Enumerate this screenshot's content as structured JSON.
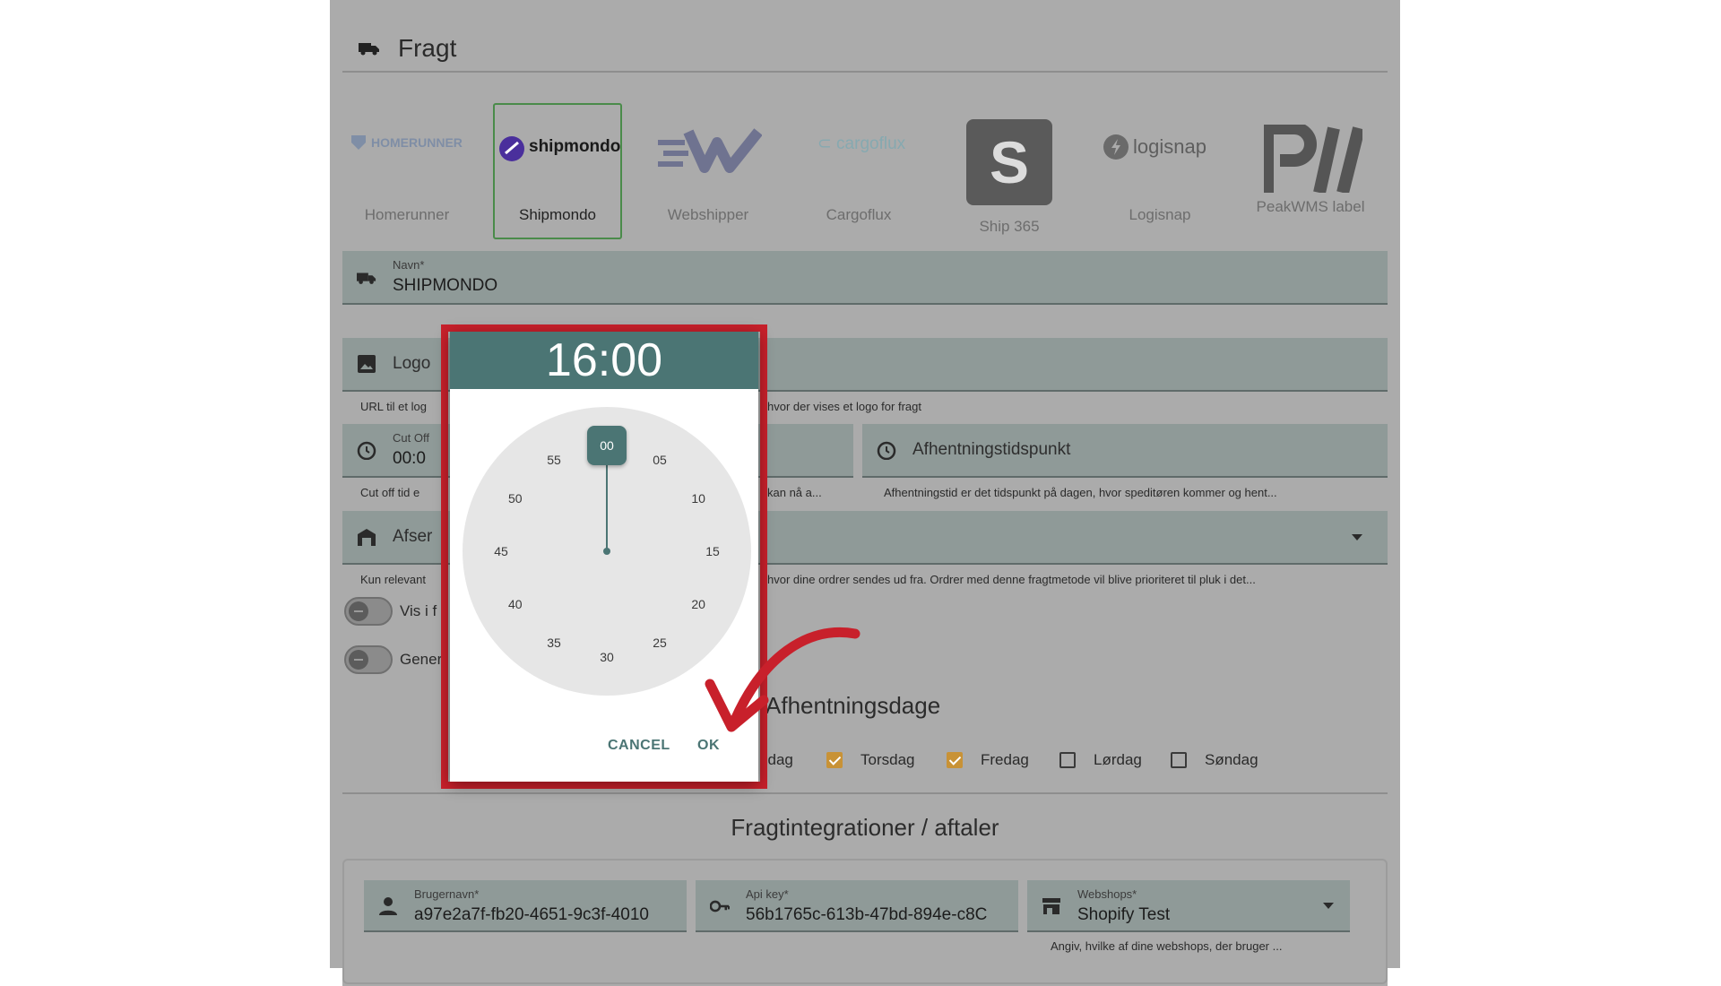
{
  "section": {
    "title": "Fragt"
  },
  "carriers": [
    {
      "logo_text": "HOMERUNNER",
      "name": "Homerunner"
    },
    {
      "logo_text": "shipmondo",
      "name": "Shipmondo",
      "selected": true
    },
    {
      "logo_text": "",
      "name": "Webshipper"
    },
    {
      "logo_text": "cargoflux",
      "name": "Cargoflux"
    },
    {
      "logo_text": "S",
      "name": "Ship 365"
    },
    {
      "logo_text": "logisnap",
      "name": "Logisnap"
    },
    {
      "logo_text": "",
      "name": "PeakWMS label"
    }
  ],
  "name_field": {
    "label": "Navn*",
    "value": "SHIPMONDO"
  },
  "logo_field": {
    "label": "Logo",
    "help_left": "URL til et log",
    "help_right": "hvor der vises et logo for fragt"
  },
  "cutoff_field": {
    "label": "Cut Off",
    "value": "00:0",
    "help_left": "Cut off tid e",
    "help_right": "kan nå a..."
  },
  "pickup_time_field": {
    "label": "Afhentningstidspunkt",
    "help": "Afhentningstid er det tidspunkt på dagen, hvor speditøren kommer og hent..."
  },
  "sender_field": {
    "label": "Afser",
    "help_left": "Kun relevant",
    "help_right": "hvor dine ordrer sendes ud fra. Ordrer med denne fragtmetode vil blive prioriteret til pluk i det..."
  },
  "toggles": [
    {
      "label": "Vis i f"
    },
    {
      "label": "Gener"
    }
  ],
  "pickup_days": {
    "title": "Afhentningsdage",
    "days": [
      {
        "label": "sdag"
      },
      {
        "label": "Torsdag",
        "checked": true
      },
      {
        "label": "Fredag",
        "checked": true
      },
      {
        "label": "Lørdag",
        "checked": false
      },
      {
        "label": "Søndag",
        "checked": false
      }
    ]
  },
  "integrations": {
    "title": "Fragtintegrationer / aftaler",
    "username": {
      "label": "Brugernavn*",
      "value": "a97e2a7f-fb20-4651-9c3f-4010"
    },
    "api_key": {
      "label": "Api key*",
      "value": "56b1765c-613b-47bd-894e-c8C"
    },
    "webshops": {
      "label": "Webshops*",
      "value": "Shopify Test",
      "help": "Angiv, hvilke af dine webshops, der bruger ..."
    }
  },
  "time_picker": {
    "time": "16:00",
    "selected_minute": "00",
    "minutes": [
      "05",
      "10",
      "15",
      "20",
      "25",
      "30",
      "35",
      "40",
      "45",
      "50",
      "55"
    ],
    "cancel_label": "CANCEL",
    "ok_label": "OK"
  },
  "colors": {
    "accent": "#4b7574",
    "highlight_frame": "#c8202b",
    "annotation_arrow": "#c8202b",
    "checkbox_checked": "#c89236"
  }
}
